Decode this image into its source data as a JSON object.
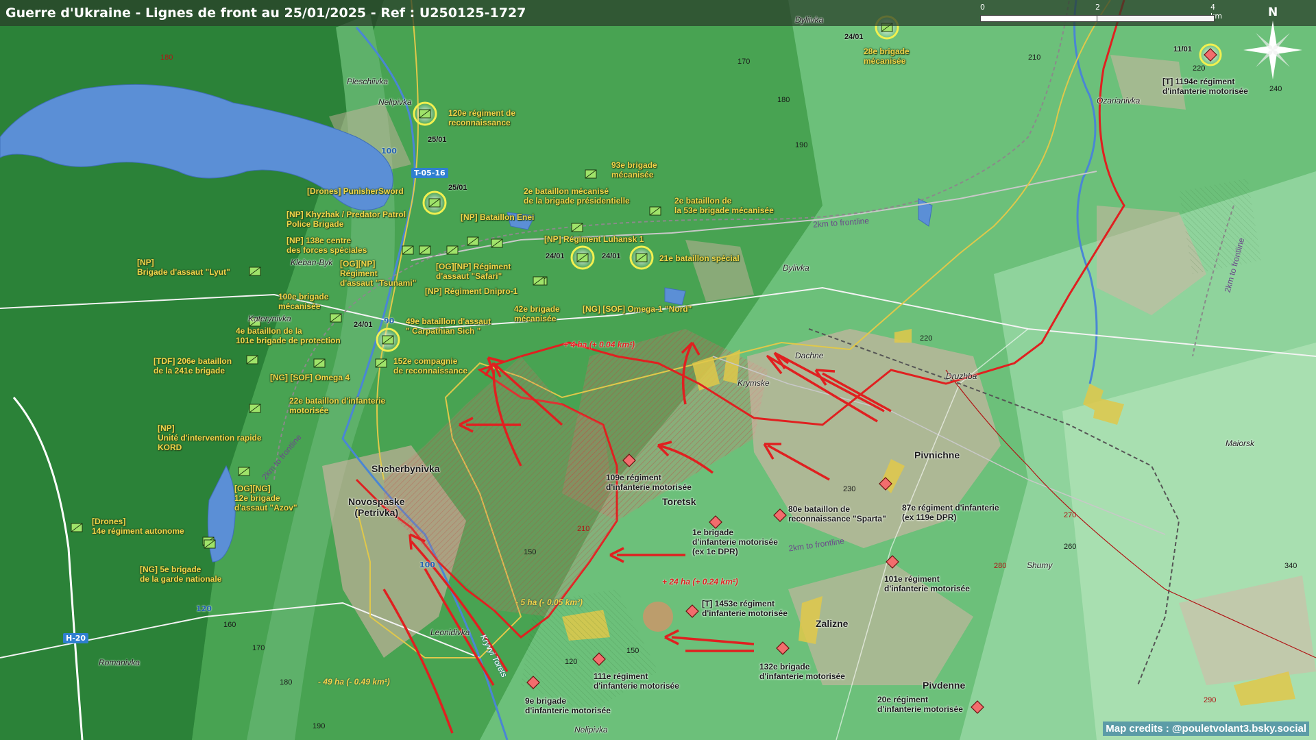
{
  "header": {
    "title": "Guerre d'Ukraine - Lignes de front au 25/01/2025 - Ref : U250125-1727",
    "scale_labels": [
      "0",
      "2",
      "4 km"
    ],
    "north": "N"
  },
  "credits": "Map credits : @pouletvolant3.bsky.social",
  "colors": {
    "friendly": "#f1d54a",
    "hostile": "#e02020",
    "water": "#5b8fd6",
    "urban": "#d8a89a"
  },
  "roads": {
    "t0516": "T-05-16",
    "h20": "H-20",
    "r100a": "100",
    "r90": "90",
    "r100b": "100",
    "r120": "120"
  },
  "frontline_labels": [
    "2km to frontline",
    "2km to frontline",
    "2km to frontline",
    "2km to frontline"
  ],
  "places": {
    "pleschiivka": "Pleschiivka",
    "nelipivka_n": "Nelipivka",
    "kleban_byk": "Kleban-Byk",
    "katerynivka": "Katerynivka",
    "shcherbynivka": "Shcherbynivka",
    "novospaske": "Novospaske\n(Petrivka)",
    "leonidivka": "Leonidivka",
    "romanivka": "Romanivka",
    "nelipivka_s": "Nelipivka",
    "toretsk": "Toretsk",
    "krymske": "Krymske",
    "dachne": "Dachne",
    "druzhba": "Druzhba",
    "dylivka": "Dylivka",
    "dyliivka_n": "Dyliivka",
    "pivnichne": "Pivnichne",
    "zalizne": "Zalizne",
    "pivdenne": "Pivdenne",
    "shumy": "Shumy",
    "maiorsk": "Maiorsk",
    "ozarianivka": "Ozarianivka",
    "kryvyi_torets": "Kryvyi Torets"
  },
  "elevations": [
    "180",
    "170",
    "180",
    "190",
    "210",
    "220",
    "240",
    "220",
    "150",
    "160",
    "170",
    "180",
    "190",
    "150",
    "120",
    "230",
    "260",
    "270",
    "280",
    "290",
    "340",
    "210"
  ],
  "changes": {
    "gain1": "+ 4 ha (+ 0.04 km²)",
    "gain2": "+ 24 ha (+ 0.24 km²)",
    "loss1": "- 5 ha (- 0.05 km²)",
    "loss2": "- 49 ha (- 0.49 km²)"
  },
  "dates": {
    "d1": "25/01",
    "d2": "25/01",
    "d3": "24/01",
    "d4": "24/01",
    "d5": "24/01",
    "d6": "24/01",
    "d7": "11/01"
  },
  "friendly_units": [
    "120e régiment de\nreconnaissance",
    "[Drones] PunisherSword",
    "[NP] Khyzhak / Predator Patrol\nPolice Brigade",
    "[NP] 138e centre\ndes forces spéciales",
    "[NP]\nBrigade d'assaut \"Lyut\"",
    "[OG][NP]\nRégiment\nd'assaut \"Tsunami\"",
    "[NP] Bataillon Enei",
    "[OG][NP] Régiment\nd'assaut \"Safari\"",
    "[NP] Régiment Dnipro-1",
    "[NP] Régiment Luhansk 1",
    "93e brigade\nmécanisée",
    "2e bataillon mécanisé\nde la brigade présidentielle",
    "2e bataillon de\nla 53e brigade mécanisée",
    "21e bataillon spécial",
    "42e brigade\nmécanisée",
    "[NG] [SOF] Omega-1 \"Nord\"",
    "100e brigade\nmécanisée",
    "4e bataillon de la\n101e brigade de protection",
    "49e bataillon d'assaut\n\" Carpathian Sich \"",
    "[TDF] 206e bataillon\nde la 241e brigade",
    "152e compagnie\nde reconnaissance",
    "[NG] [SOF] Omega 4",
    "22e bataillon d'infanterie\nmotorisée",
    "[NP]\nUnité d'intervention rapide\nKORD",
    "[OG][NG]\n12e brigade\nd'assaut \"Azov\"",
    "[Drones]\n14e régiment autonome",
    "[NG] 5e brigade\nde la garde nationale",
    "28e brigade\nmécanisée"
  ],
  "hostile_units": [
    "109e régiment\nd'infanterie motorisée",
    "1e brigade\nd'infanterie motorisée\n(ex 1e DPR)",
    "80e bataillon de\nreconnaissance \"Sparta\"",
    "87e régiment d'infanterie\n(ex 119e DPR)",
    "101e régiment\nd'infanterie motorisée",
    "[T] 1453e régiment\nd'infanterie motorisée",
    "132e brigade\nd'infanterie motorisée",
    "111e régiment\nd'infanterie motorisée",
    "9e brigade\nd'infanterie motorisée",
    "20e régiment\nd'infanterie motorisée",
    "[T] 1194e régiment\nd'infanterie motorisée"
  ]
}
